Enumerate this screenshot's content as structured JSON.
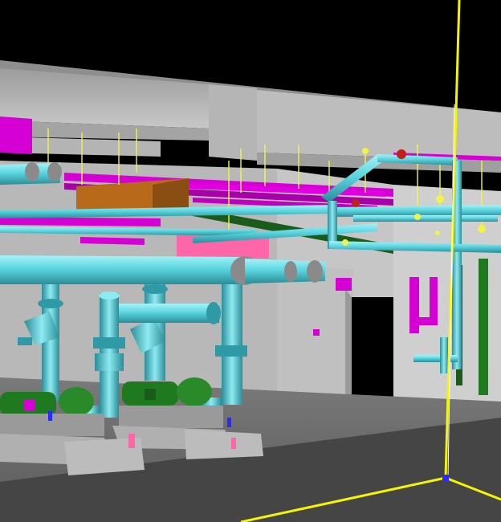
{
  "viewport": {
    "background_color": "#000000",
    "colors": {
      "concrete_light": "#c9c9c9",
      "concrete_mid": "#a8a8a8",
      "concrete_dark": "#7c7c7c",
      "floor": "#6a6a6a",
      "pipe_cyan": "#5cd6e0",
      "pipe_cyan_dark": "#2f9aa6",
      "duct_magenta": "#d400d4",
      "pump_green": "#1f7a1f",
      "hanger_yellow": "#f2f24a",
      "axis_yellow": "#f5f500",
      "axis_blue": "#2a2aff",
      "tray_green": "#1a5a1a",
      "duct_orange": "#b86a1a",
      "pink_panel": "#ff66aa"
    },
    "icons": [
      "pump-icon",
      "valve-icon",
      "axis-gizmo-icon"
    ]
  }
}
